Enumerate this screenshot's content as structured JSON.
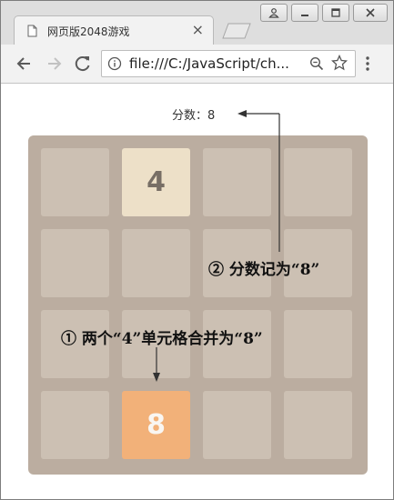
{
  "tab": {
    "title": "网页版2048游戏",
    "close_glyph": "×"
  },
  "address_bar": {
    "url": "file:///C:/JavaScript/ch..."
  },
  "game": {
    "score_label": "分数：8",
    "tiles": [
      [
        "",
        "4",
        "",
        ""
      ],
      [
        "",
        "",
        "",
        ""
      ],
      [
        "",
        "",
        "",
        ""
      ],
      [
        "",
        "8",
        "",
        ""
      ]
    ],
    "tile_colors": {
      "empty": "#ccc0b3",
      "4": "#ede0c8",
      "8": "#f2b179",
      "board": "#bbada0"
    }
  },
  "annotations": {
    "score_note": "② 分数记为“8”",
    "merge_note": "① 两个“4”单元格合并为“8”"
  },
  "icons": [
    "page-icon",
    "close-icon",
    "back-arrow-icon",
    "forward-arrow-icon",
    "reload-icon",
    "info-icon",
    "zoom-icon",
    "star-icon",
    "menu-icon",
    "user-icon",
    "minimize-icon",
    "maximize-icon",
    "window-close-icon"
  ]
}
